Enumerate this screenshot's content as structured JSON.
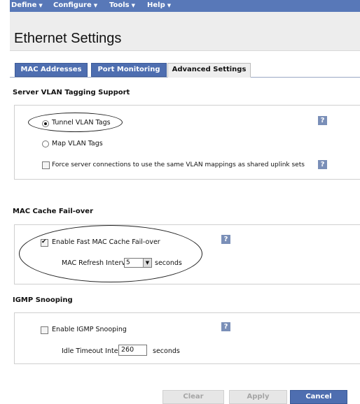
{
  "menu": {
    "items": [
      {
        "label": "Define"
      },
      {
        "label": "Configure"
      },
      {
        "label": "Tools"
      },
      {
        "label": "Help"
      }
    ]
  },
  "page": {
    "title": "Ethernet Settings"
  },
  "tabs": [
    {
      "label": "MAC Addresses"
    },
    {
      "label": "Port Monitoring"
    },
    {
      "label": "Advanced Settings",
      "active": true
    }
  ],
  "vlan": {
    "title": "Server VLAN Tagging Support",
    "tunnel_label": "Tunnel VLAN Tags",
    "map_label": "Map VLAN Tags",
    "force_label": "Force server connections to use the same VLAN mappings as shared uplink sets",
    "selected": "tunnel"
  },
  "mac_cache": {
    "title": "MAC Cache Fail-over",
    "enable_label": "Enable Fast MAC Cache Fail-over",
    "enabled": true,
    "interval_label": "MAC Refresh Interval",
    "interval_value": "5",
    "units": "seconds"
  },
  "igmp": {
    "title": "IGMP Snooping",
    "enable_label": "Enable IGMP Snooping",
    "enabled": false,
    "timeout_label": "Idle Timeout Interval",
    "timeout_value": "260",
    "units": "seconds"
  },
  "help_label": "?",
  "buttons": {
    "clear": "Clear",
    "apply": "Apply",
    "cancel": "Cancel"
  },
  "colors": {
    "menu_bg": "#5878b8",
    "tab_bg": "#4e6eb0",
    "help_bg": "#7a8fb8"
  }
}
